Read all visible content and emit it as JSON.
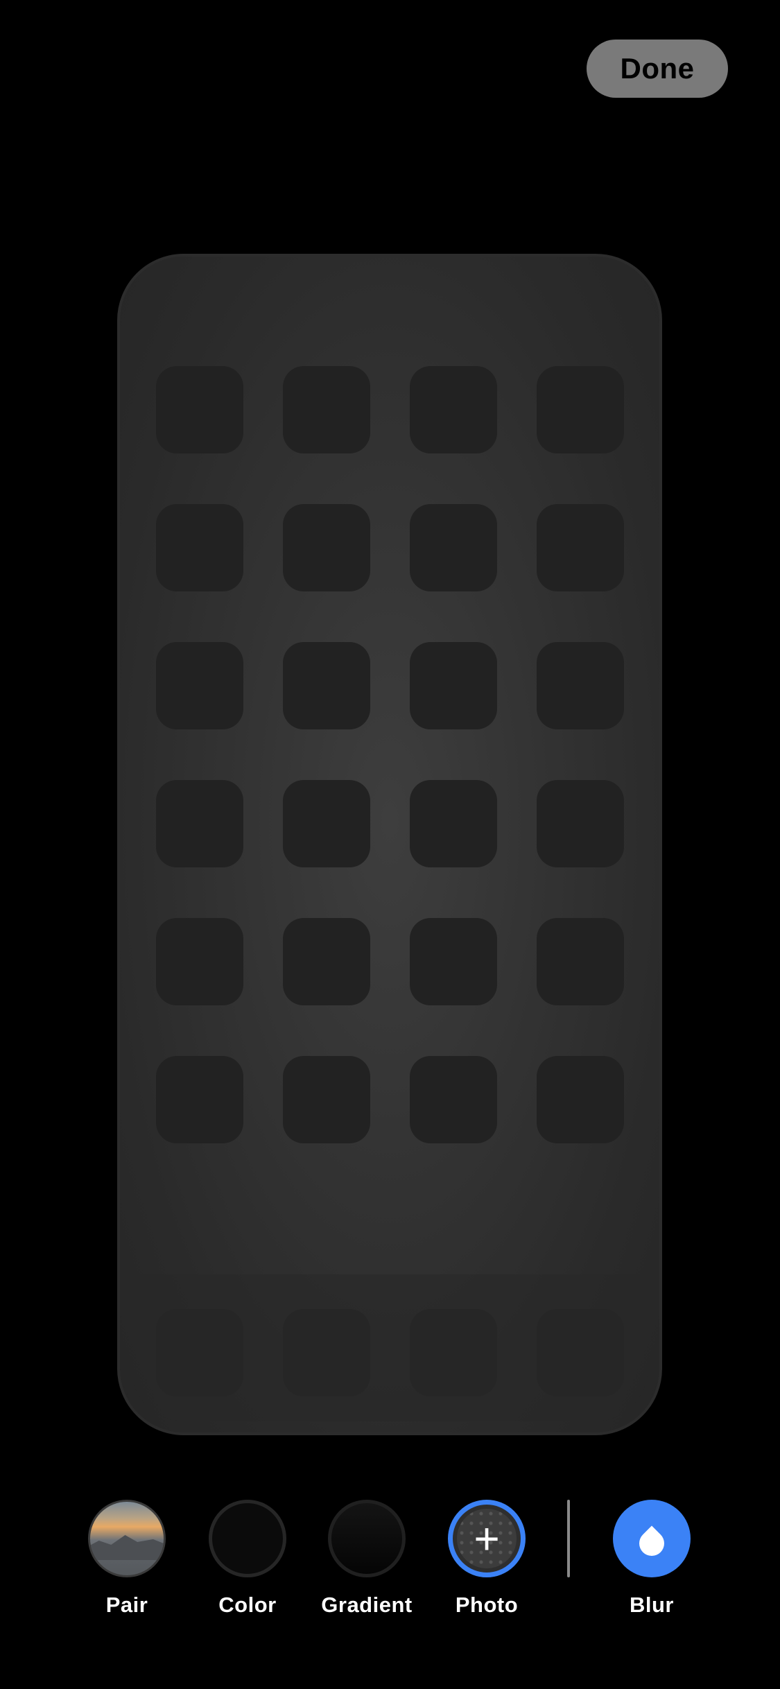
{
  "done_label": "Done",
  "options": {
    "pair": "Pair",
    "color": "Color",
    "gradient": "Gradient",
    "photo": "Photo",
    "blur": "Blur"
  },
  "photo_icon": "+",
  "colors": {
    "accent": "#3b82f6",
    "background": "#000000"
  }
}
